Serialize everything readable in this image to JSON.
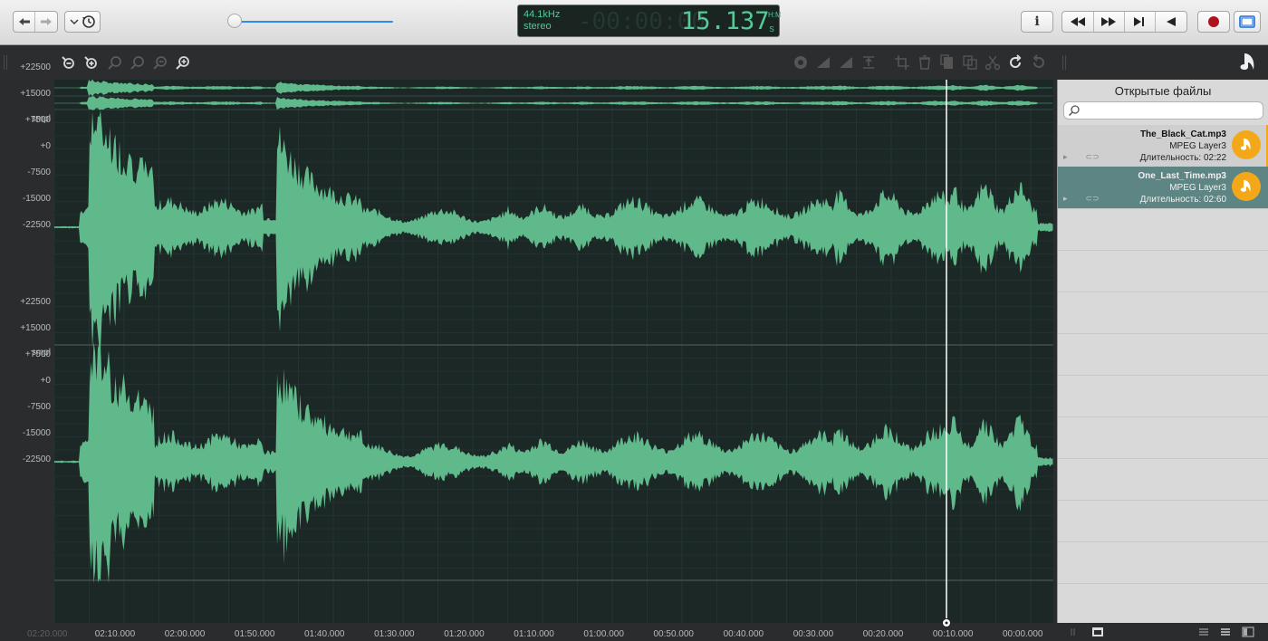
{
  "toolbar": {
    "back_icon": "arrow-left-icon",
    "forward_icon": "arrow-right-icon",
    "history_icon": "history-icon",
    "volume_level": 0.03,
    "info_label": "i"
  },
  "display": {
    "sample_rate": "44.1kHz",
    "channels": "stereo",
    "ghost_digits": "-00:00:00",
    "time": "15.137",
    "side_top": "H:M",
    "side_bottom": "S"
  },
  "transport": {
    "rewind_icon": "rewind-icon",
    "fast_forward_icon": "fast-forward-icon",
    "to_end_icon": "skip-to-end-icon",
    "play_icon": "play-icon",
    "record_icon": "record-icon",
    "view_icon": "panel-icon"
  },
  "ruler": {
    "unit": "smpl",
    "labels": [
      "+22500",
      "+15000",
      "+7500",
      "+0",
      "-7500",
      "-15000",
      "-22500"
    ]
  },
  "timeline": {
    "labels": [
      "00:00.000",
      "00:10.000",
      "00:20.000",
      "00:30.000",
      "00:40.000",
      "00:50.000",
      "01:00.000",
      "01:10.000",
      "01:20.000",
      "01:30.000",
      "01:40.000",
      "01:50.000",
      "02:00.000",
      "02:10.000"
    ],
    "end_label": "02:20.000"
  },
  "sidebar": {
    "title": "Открытые файлы",
    "search_placeholder": "",
    "files": [
      {
        "name": "The_Black_Cat.mp3",
        "format": "MPEG Layer3",
        "duration": "Длительность: 02:22"
      },
      {
        "name": "One_Last_Time.mp3",
        "format": "MPEG Layer3",
        "duration": "Длительность: 02:60"
      }
    ]
  },
  "colors": {
    "wave": "#5fb98a",
    "wave_bg": "#1c2826",
    "accent": "#f3a81a",
    "selected_row": "#5c8583"
  }
}
